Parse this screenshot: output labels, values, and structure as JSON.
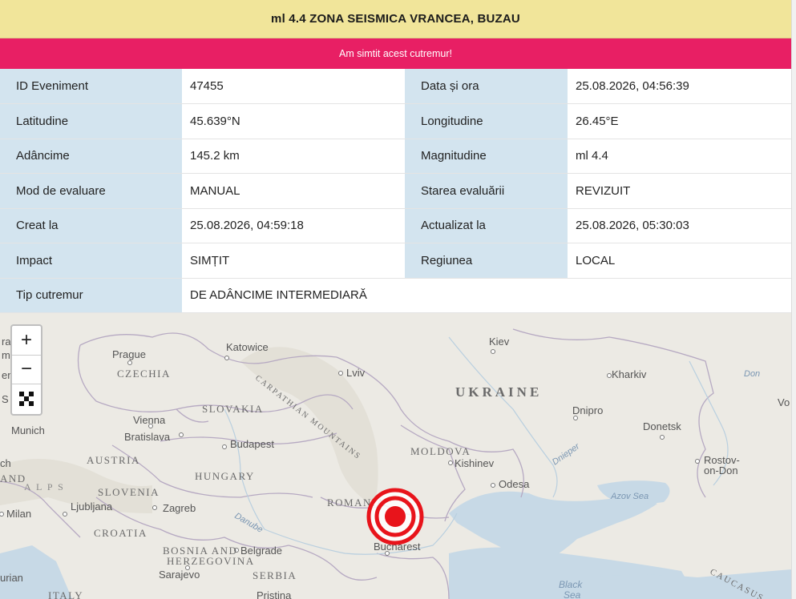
{
  "header": {
    "title": "ml 4.4 ZONA SEISMICA VRANCEA, BUZAU",
    "felt_button": "Am simtit acest cutremur!"
  },
  "colors": {
    "title_bg": "#f1e59a",
    "felt_bg": "#e81f64",
    "label_bg": "#d3e4ef",
    "epicenter": "#e8141b"
  },
  "details": {
    "event_id_label": "ID Eveniment",
    "event_id": "47455",
    "datetime_label": "Data și ora",
    "datetime": "25.08.2026, 04:56:39",
    "lat_label": "Latitudine",
    "lat": "45.639°N",
    "lon_label": "Longitudine",
    "lon": "26.45°E",
    "depth_label": "Adâncime",
    "depth": "145.2 km",
    "mag_label": "Magnitudine",
    "mag": "ml 4.4",
    "mode_label": "Mod de evaluare",
    "mode": "MANUAL",
    "status_label": "Starea evaluării",
    "status": "REVIZUIT",
    "created_label": "Creat la",
    "created": "25.08.2026, 04:59:18",
    "updated_label": "Actualizat la",
    "updated": "25.08.2026, 05:30:03",
    "impact_label": "Impact",
    "impact": "SIMȚIT",
    "region_label": "Regiunea",
    "region": "LOCAL",
    "type_label": "Tip cutremur",
    "type": "DE ADÂNCIME INTERMEDIARĂ"
  },
  "map": {
    "zoom_in": "+",
    "zoom_out": "−",
    "fullscreen_icon": "fullscreen-icon",
    "labels": {
      "prague": "Prague",
      "czechia": "CZECHIA",
      "katowice": "Katowice",
      "lviv": "Lviv",
      "kiev": "Kiev",
      "kharkiv": "Kharkiv",
      "don": "Don",
      "ukraine": "UKRAINE",
      "carpathian": "CARPATHIAN MOUNTAINS",
      "slovakia": "SLOVAKIA",
      "vienna": "Vienna",
      "bratislava": "Bratislava",
      "munich": "Munich",
      "dnipro": "Dnipro",
      "donetsk": "Donetsk",
      "budapest": "Budapest",
      "austria": "AUSTRIA",
      "moldova": "MOLDOVA",
      "kishinev": "Kishinev",
      "dnieper": "Dnieper",
      "rostov": "Rostov-",
      "rostov2": "on-Don",
      "hungary": "HUNGARY",
      "odesa": "Odesa",
      "slovenia": "SLOVENIA",
      "ljubljana": "Ljubljana",
      "zagreb": "Zagreb",
      "milan": "Milan",
      "romania": "ROMANIA",
      "azov": "Azov Sea",
      "danube": "Danube",
      "croatia": "CROATIA",
      "bucharest": "Bucharest",
      "bosnia": "BOSNIA AND",
      "herzegovina": "HERZEGOVINA",
      "belgrade": "Belgrade",
      "sarajevo": "Sarajevo",
      "serbia": "SERBIA",
      "black_sea": "Black",
      "black_sea2": "Sea",
      "caucasus": "CAUCASUS",
      "italy": "ITALY",
      "pristina": "Pristina",
      "alps": "A L P S",
      "and": "AND",
      "ch": "ch",
      "ra": "ra",
      "m": "m",
      "en": "en",
      "st": "S   rt",
      "vo": "Vo",
      "urian": "urian"
    }
  }
}
